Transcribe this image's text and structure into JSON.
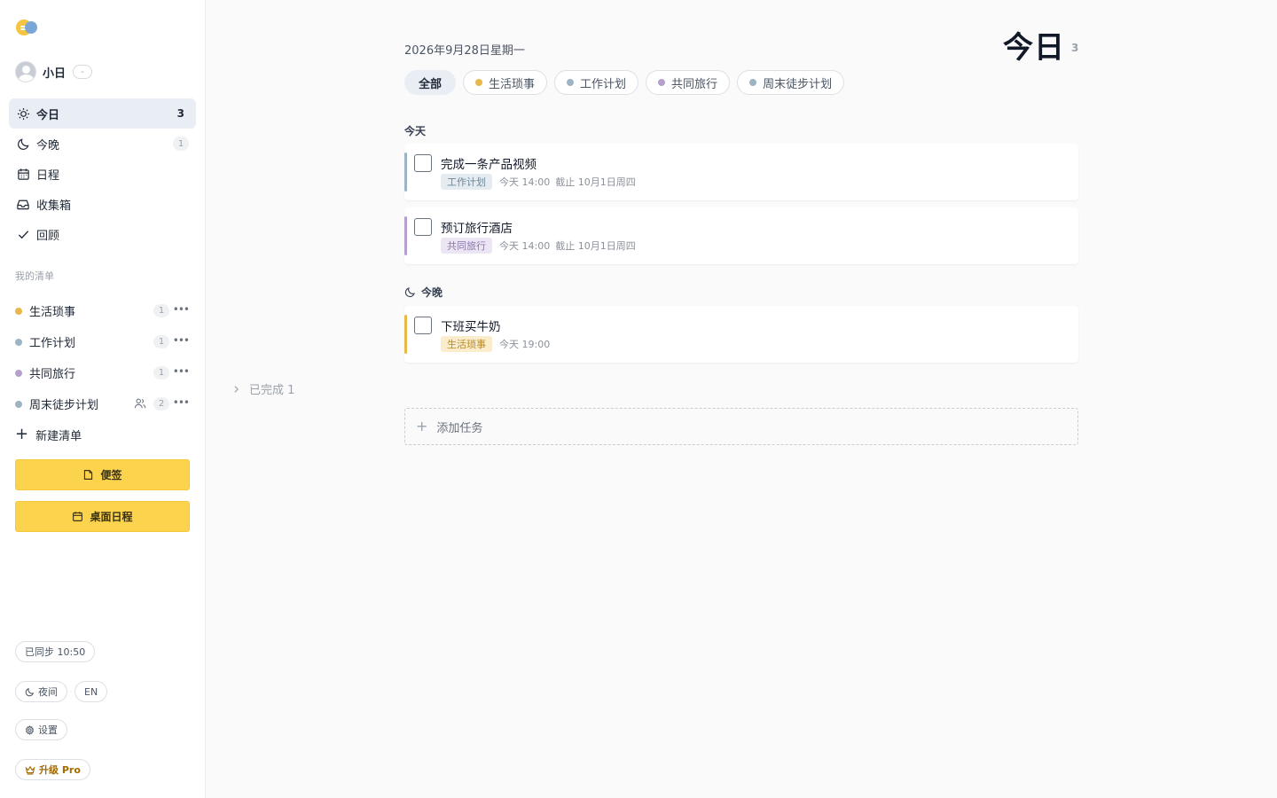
{
  "user": {
    "name": "小日",
    "badge": "-"
  },
  "nav": [
    {
      "label": "今日",
      "count": "3",
      "icon": "sun-icon"
    },
    {
      "label": "今晚",
      "count": "1",
      "icon": "moon-icon"
    },
    {
      "label": "日程",
      "icon": "calendar-icon"
    },
    {
      "label": "收集箱",
      "icon": "inbox-icon"
    },
    {
      "label": "回顾",
      "icon": "check-icon"
    }
  ],
  "lists_title": "我的清单",
  "lists": [
    {
      "label": "生活琐事",
      "count": "1",
      "color": "#e8b84a"
    },
    {
      "label": "工作计划",
      "count": "1",
      "color": "#9db4c4"
    },
    {
      "label": "共同旅行",
      "count": "1",
      "color": "#b49fcf"
    },
    {
      "label": "周末徒步计划",
      "count": "2",
      "color": "#9db4c4",
      "shared": true
    }
  ],
  "new_list_label": "新建清单",
  "buttons": {
    "sticky": "便签",
    "desktop_schedule": "桌面日程"
  },
  "footer": {
    "sync": "已同步 10:50",
    "night": "夜间",
    "lang": "EN",
    "settings": "设置",
    "upgrade": "升级 Pro"
  },
  "main": {
    "date": "2026年9月28日星期一",
    "title": "今日",
    "count": "3",
    "filters": [
      {
        "label": "全部",
        "active": true
      },
      {
        "label": "生活琐事",
        "color": "#e8b84a"
      },
      {
        "label": "工作计划",
        "color": "#9db4c4"
      },
      {
        "label": "共同旅行",
        "color": "#b49fcf"
      },
      {
        "label": "周末徒步计划",
        "color": "#9db4c4"
      }
    ],
    "groups": {
      "today": "今天",
      "tonight": "今晚"
    },
    "tasks": [
      {
        "title": "完成一条产品视频",
        "tag": "工作计划",
        "tag_bg": "#e4ecf1",
        "tag_fg": "#6c8798",
        "bar": "#9db4c4",
        "time": "今天 14:00",
        "due": "截止 10月1日周四"
      },
      {
        "title": "预订旅行酒店",
        "tag": "共同旅行",
        "tag_bg": "#ece6f4",
        "tag_fg": "#8a77a8",
        "bar": "#b49fcf",
        "time": "今天 14:00",
        "due": "截止 10月1日周四"
      },
      {
        "title": "下班买牛奶",
        "tag": "生活琐事",
        "tag_bg": "#fbeccb",
        "tag_fg": "#b88a26",
        "bar": "#e8b84a",
        "time": "今天 19:00"
      }
    ],
    "completed": "已完成 1",
    "add_task": "添加任务"
  }
}
